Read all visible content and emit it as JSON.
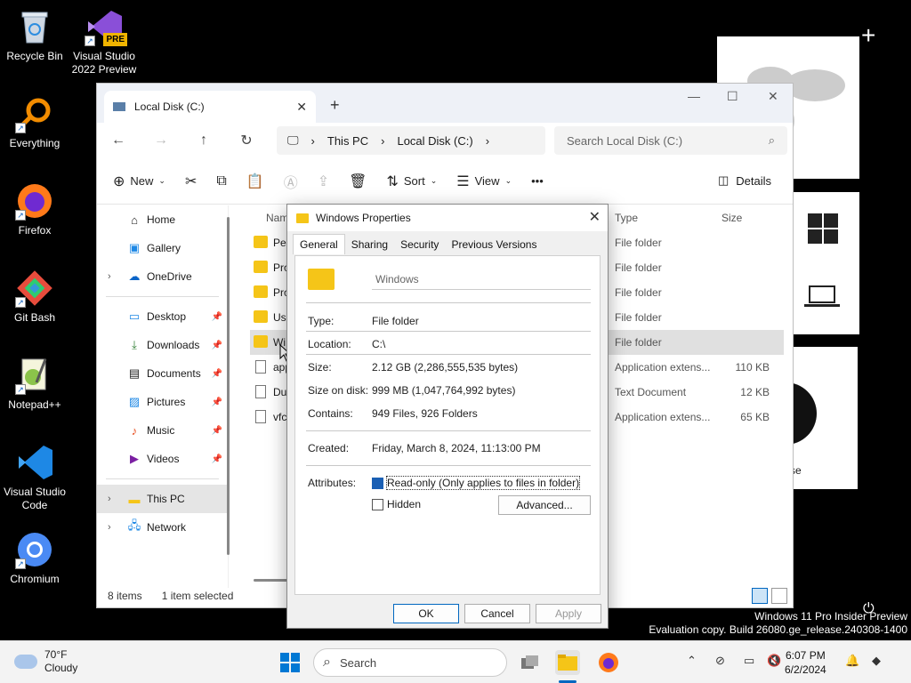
{
  "desktop": {
    "icons": [
      {
        "label": "Recycle Bin",
        "icon": "recycle-bin-icon"
      },
      {
        "label": "Visual Studio 2022 Preview",
        "icon": "visual-studio-icon",
        "badge": "PRE"
      },
      {
        "label": "Everything",
        "icon": "everything-search-icon"
      },
      {
        "label": "Firefox",
        "icon": "firefox-icon"
      },
      {
        "label": "Git Bash",
        "icon": "git-bash-icon"
      },
      {
        "label": "Notepad++",
        "icon": "notepad-plus-plus-icon"
      },
      {
        "label": "Visual Studio Code",
        "icon": "vscode-icon"
      },
      {
        "label": "Chromium",
        "icon": "chromium-icon"
      }
    ],
    "bg_panel_text": "se"
  },
  "explorer": {
    "tab_title": "Local Disk (C:)",
    "breadcrumb": [
      "This PC",
      "Local Disk (C:)"
    ],
    "search_placeholder": "Search Local Disk (C:)",
    "toolbar": {
      "new_label": "New",
      "sort_label": "Sort",
      "view_label": "View",
      "more_label": "•••",
      "details_label": "Details"
    },
    "sidebar": {
      "home": "Home",
      "gallery": "Gallery",
      "onedrive": "OneDrive",
      "desktop": "Desktop",
      "downloads": "Downloads",
      "documents": "Documents",
      "pictures": "Pictures",
      "music": "Music",
      "videos": "Videos",
      "this_pc": "This PC",
      "network": "Network"
    },
    "columns": {
      "name": "Nam",
      "type": "Type",
      "size": "Size"
    },
    "files": [
      {
        "name": "Per",
        "type": "File folder",
        "size": "",
        "kind": "folder"
      },
      {
        "name": "Pro",
        "type": "File folder",
        "size": "",
        "kind": "folder"
      },
      {
        "name": "Pro",
        "type": "File folder",
        "size": "",
        "kind": "folder"
      },
      {
        "name": "Use",
        "type": "File folder",
        "size": "",
        "kind": "folder"
      },
      {
        "name": "Wi",
        "type": "File folder",
        "size": "",
        "kind": "folder"
      },
      {
        "name": "app",
        "type": "Application extens...",
        "size": "110 KB",
        "kind": "file"
      },
      {
        "name": "Dui",
        "type": "Text Document",
        "size": "12 KB",
        "kind": "file"
      },
      {
        "name": "vfc",
        "type": "Application extens...",
        "size": "65 KB",
        "kind": "file"
      }
    ],
    "status": {
      "items": "8 items",
      "selected": "1 item selected"
    }
  },
  "dialog": {
    "title": "Windows Properties",
    "tabs": [
      "General",
      "Sharing",
      "Security",
      "Previous Versions"
    ],
    "folder_name": "Windows",
    "props": {
      "type_label": "Type:",
      "type_value": "File folder",
      "location_label": "Location:",
      "location_value": "C:\\",
      "size_label": "Size:",
      "size_value": "2.12 GB (2,286,555,535 bytes)",
      "size_on_disk_label": "Size on disk:",
      "size_on_disk_value": "999 MB (1,047,764,992 bytes)",
      "contains_label": "Contains:",
      "contains_value": "949 Files, 926 Folders",
      "created_label": "Created:",
      "created_value": "Friday, March 8, 2024, 11:13:00 PM",
      "attributes_label": "Attributes:",
      "readonly_label": "Read-only (Only applies to files in folder)",
      "hidden_label": "Hidden",
      "advanced_label": "Advanced..."
    },
    "buttons": {
      "ok": "OK",
      "cancel": "Cancel",
      "apply": "Apply"
    }
  },
  "watermark": {
    "line1": "Windows 11 Pro Insider Preview",
    "line2": "Evaluation copy. Build 26080.ge_release.240308-1400"
  },
  "taskbar": {
    "weather_temp": "70°F",
    "weather_desc": "Cloudy",
    "search_label": "Search",
    "time": "6:07 PM",
    "date": "6/2/2024"
  }
}
